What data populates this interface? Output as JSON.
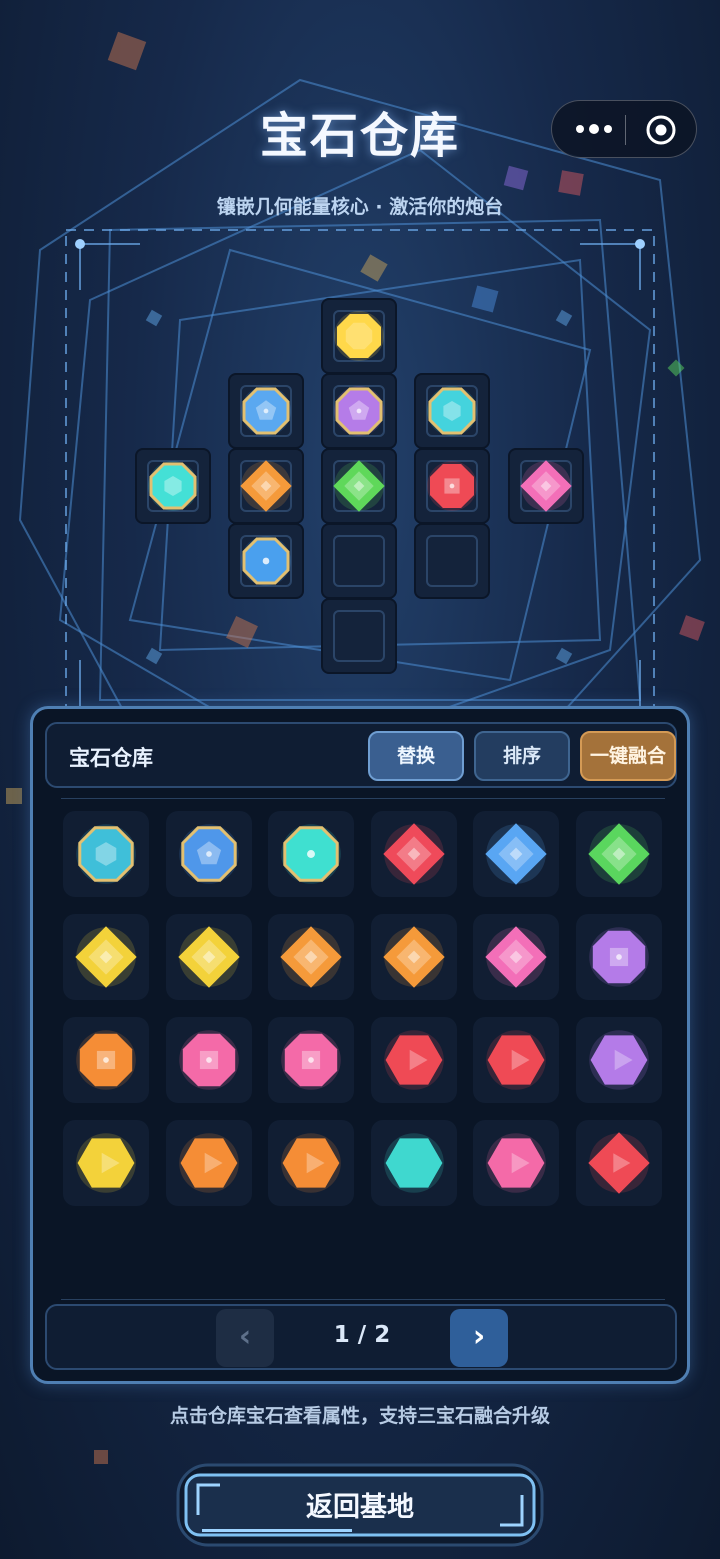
{
  "header": {
    "title": "宝石仓库",
    "subtitle": "镶嵌几何能量核心 · 激活你的炮台"
  },
  "capsule": {
    "more_icon": "more-dots-icon",
    "target_icon": "target-icon"
  },
  "board": {
    "slots": [
      {
        "id": "r0c2",
        "gem": {
          "shape": "octagon",
          "color": "#ffd84a"
        }
      },
      {
        "id": "r1c1",
        "gem": {
          "shape": "octagon-pentagon",
          "color": "#5aa8f0",
          "ring": "#e2c071"
        }
      },
      {
        "id": "r1c2",
        "gem": {
          "shape": "octagon-pentagon",
          "color": "#b57ce8",
          "ring": "#e2c071"
        }
      },
      {
        "id": "r1c3",
        "gem": {
          "shape": "octagon-hexagon",
          "color": "#44d3dd",
          "ring": "#e2c071"
        }
      },
      {
        "id": "r2c0",
        "gem": {
          "shape": "octagon-hexagon",
          "color": "#44e0d6",
          "ring": "#e2c071"
        }
      },
      {
        "id": "r2c1",
        "gem": {
          "shape": "diamond",
          "color": "#f59a3a"
        }
      },
      {
        "id": "r2c2",
        "gem": {
          "shape": "diamond",
          "color": "#5fd85a"
        }
      },
      {
        "id": "r2c3",
        "gem": {
          "shape": "octagon-square",
          "color": "#ef4a55"
        }
      },
      {
        "id": "r2c4",
        "gem": {
          "shape": "diamond",
          "color": "#f36fb8"
        }
      },
      {
        "id": "r3c1",
        "gem": {
          "shape": "octagon-circle",
          "color": "#4aa0ee",
          "ring": "#e2c071"
        }
      },
      {
        "id": "r3c2",
        "gem": null
      },
      {
        "id": "r3c3",
        "gem": null
      },
      {
        "id": "r4c2",
        "gem": null
      }
    ]
  },
  "inventory": {
    "title": "宝石仓库",
    "replace_label": "替换",
    "sort_label": "排序",
    "fuse_label": "一键融合",
    "items": [
      {
        "shape": "octagon-hexagon",
        "color": "#3fbfd9",
        "ring": "#e2c071"
      },
      {
        "shape": "octagon-pentagon",
        "color": "#4f97ea",
        "ring": "#e2c071"
      },
      {
        "shape": "octagon-circle",
        "color": "#3fe0d0",
        "ring": "#e2c071"
      },
      {
        "shape": "diamond",
        "color": "#ef4a5a"
      },
      {
        "shape": "diamond",
        "color": "#59a6f3"
      },
      {
        "shape": "diamond",
        "color": "#5ad65e"
      },
      {
        "shape": "diamond",
        "color": "#f3d23a"
      },
      {
        "shape": "diamond",
        "color": "#f3d23a"
      },
      {
        "shape": "diamond",
        "color": "#f59a3a"
      },
      {
        "shape": "diamond",
        "color": "#f59a3a"
      },
      {
        "shape": "diamond",
        "color": "#f36fb8"
      },
      {
        "shape": "octagon-square",
        "color": "#b47be8"
      },
      {
        "shape": "octagon-square",
        "color": "#f58d36"
      },
      {
        "shape": "octagon-square",
        "color": "#f46aa8"
      },
      {
        "shape": "octagon-square",
        "color": "#f46aa8"
      },
      {
        "shape": "hexagon-triangle",
        "color": "#ef4a55"
      },
      {
        "shape": "hexagon-triangle",
        "color": "#ef4a55"
      },
      {
        "shape": "hexagon-triangle",
        "color": "#b47be8"
      },
      {
        "shape": "hexagon-triangle",
        "color": "#f3d23a"
      },
      {
        "shape": "hexagon-triangle",
        "color": "#f58d36"
      },
      {
        "shape": "hexagon-triangle",
        "color": "#f58d36"
      },
      {
        "shape": "hexagon",
        "color": "#3fd8cf"
      },
      {
        "shape": "hexagon-triangle",
        "color": "#f46aa8"
      },
      {
        "shape": "diamond-triangle",
        "color": "#ef4a55"
      }
    ]
  },
  "pager": {
    "prev": "‹",
    "next": "›",
    "page": "1 / 2"
  },
  "hint": "点击仓库宝石查看属性，支持三宝石融合升级",
  "return_label": "返回基地"
}
